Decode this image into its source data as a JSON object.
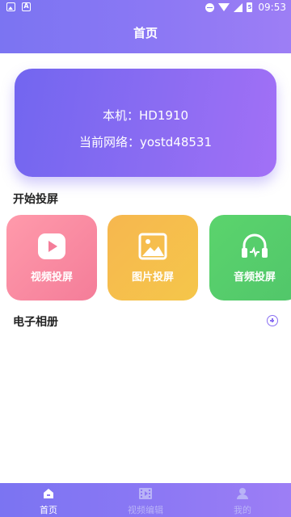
{
  "status_bar": {
    "time": "09:53",
    "battery": "5"
  },
  "header": {
    "title": "首页"
  },
  "device": {
    "name_line": "本机：HD1910",
    "network_line": "当前网络：yostd48531"
  },
  "start_cast": {
    "title": "开始投屏",
    "tiles": [
      {
        "label": "视频投屏",
        "icon": "play-icon"
      },
      {
        "label": "图片投屏",
        "icon": "image-icon"
      },
      {
        "label": "音频投屏",
        "icon": "headphones-icon"
      }
    ]
  },
  "album": {
    "title": "电子相册"
  },
  "bottom_nav": {
    "items": [
      {
        "label": "首页",
        "icon": "home-icon",
        "active": true
      },
      {
        "label": "视频编辑",
        "icon": "film-icon",
        "active": false
      },
      {
        "label": "我的",
        "icon": "user-icon",
        "active": false
      }
    ]
  },
  "colors": {
    "accent": "#8c78f4",
    "video_tile": "#f47d99",
    "photo_tile": "#f6b74f",
    "audio_tile": "#51c66a"
  }
}
